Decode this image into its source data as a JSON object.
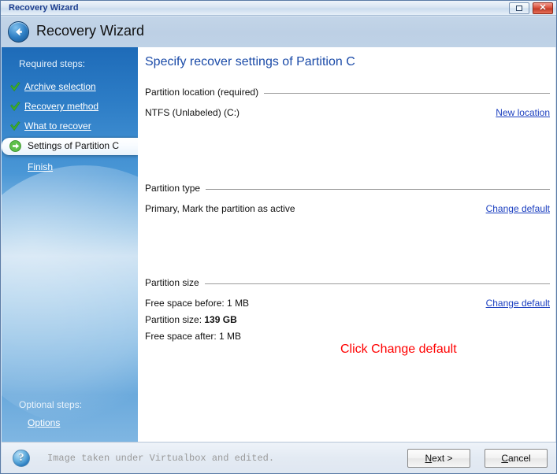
{
  "window": {
    "title": "Recovery Wizard",
    "controls": {
      "restore_label": "Restore",
      "restore_icon": "restore-icon",
      "close_label": "✕",
      "close_icon": "close-icon"
    }
  },
  "header": {
    "back_icon": "back-arrow-icon",
    "title": "Recovery Wizard"
  },
  "sidebar": {
    "required_label": "Required steps:",
    "optional_label": "Optional steps:",
    "options_link": "Options",
    "steps": [
      {
        "label": "Archive selection",
        "state": "done",
        "icon": "check-icon"
      },
      {
        "label": "Recovery method",
        "state": "done",
        "icon": "check-icon"
      },
      {
        "label": "What to recover",
        "state": "done",
        "icon": "check-icon"
      },
      {
        "label": "Settings of Partition C",
        "state": "current",
        "icon": "green-arrow-icon"
      },
      {
        "label": "Finish",
        "state": "pending",
        "icon": "none"
      }
    ]
  },
  "main": {
    "page_title": "Specify recover settings of Partition C",
    "sections": [
      {
        "heading": "Partition location (required)",
        "value": "NTFS (Unlabeled) (C:)",
        "action": "New location"
      },
      {
        "heading": "Partition type",
        "value": "Primary, Mark the partition as active",
        "action": "Change default"
      },
      {
        "heading": "Partition size",
        "action": "Change default",
        "lines": [
          {
            "text": "Free space before: 1 MB"
          },
          {
            "prefix": "Partition size: ",
            "bold": "139  GB"
          },
          {
            "text": "Free space after: 1 MB"
          }
        ]
      }
    ]
  },
  "annotation": {
    "text": "Click Change default",
    "color": "#ff0000",
    "arrow_icon": "red-arrow-icon"
  },
  "footer": {
    "help_icon": "help-question-icon",
    "status_text": "Image taken under Virtualbox and edited.",
    "next_mnemonic": "N",
    "next_rest": "ext >",
    "cancel_mnemonic": "C",
    "cancel_rest": "ancel"
  },
  "colors": {
    "accent_blue": "#1b4ba8",
    "link_blue": "#1b3fc0",
    "annotation_red": "#ff0000",
    "sidebar_blue": "#2d7dc6",
    "check_green": "#3cad2f"
  }
}
